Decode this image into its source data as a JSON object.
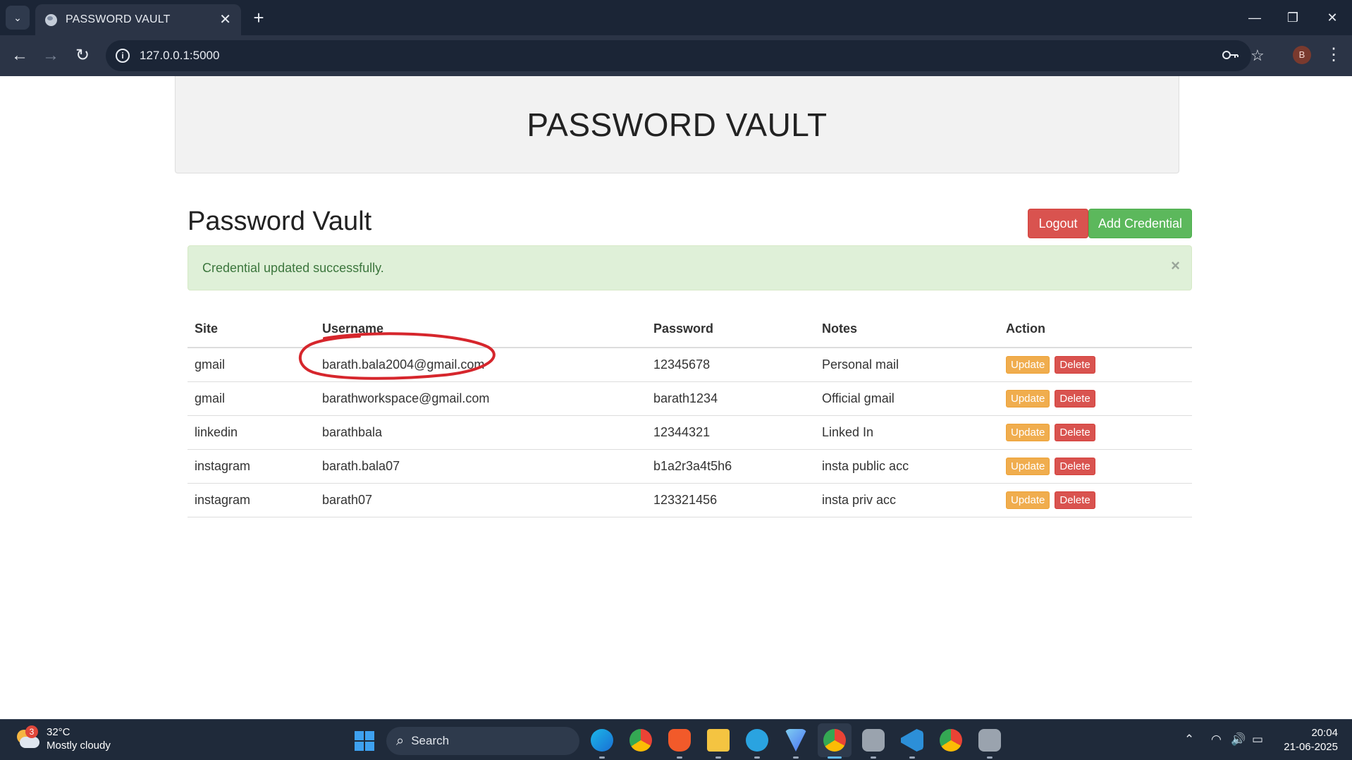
{
  "browser": {
    "tab_title": "PASSWORD VAULT",
    "url": "127.0.0.1:5000",
    "profile_initial": "B"
  },
  "page": {
    "banner_title": "PASSWORD VAULT",
    "heading": "Password Vault",
    "logout_label": "Logout",
    "add_credential_label": "Add Credential",
    "alert_message": "Credential updated successfully.",
    "alert_close": "×"
  },
  "table": {
    "headers": [
      "Site",
      "Username",
      "Password",
      "Notes",
      "Action"
    ],
    "rows": [
      {
        "site": "gmail",
        "username": "barath.bala2004@gmail.com",
        "password": "12345678",
        "notes": "Personal mail"
      },
      {
        "site": "gmail",
        "username": "barathworkspace@gmail.com",
        "password": "barath1234",
        "notes": "Official gmail"
      },
      {
        "site": "linkedin",
        "username": "barathbala",
        "password": "12344321",
        "notes": "Linked In"
      },
      {
        "site": "instagram",
        "username": "barath.bala07",
        "password": "b1a2r3a4t5h6",
        "notes": "insta public acc"
      },
      {
        "site": "instagram",
        "username": "barath07",
        "password": "123321456",
        "notes": "insta priv acc"
      }
    ],
    "update_label": "Update",
    "delete_label": "Delete"
  },
  "taskbar": {
    "weather_temp": "32°C",
    "weather_desc": "Mostly cloudy",
    "weather_badge": "3",
    "search_label": "Search",
    "time": "20:04",
    "date": "21-06-2025"
  },
  "colors": {
    "danger": "#d9534f",
    "success": "#5cb85c",
    "warning": "#f0ad4e",
    "alert_bg": "#dff0d8",
    "annotation": "#d6262c"
  }
}
